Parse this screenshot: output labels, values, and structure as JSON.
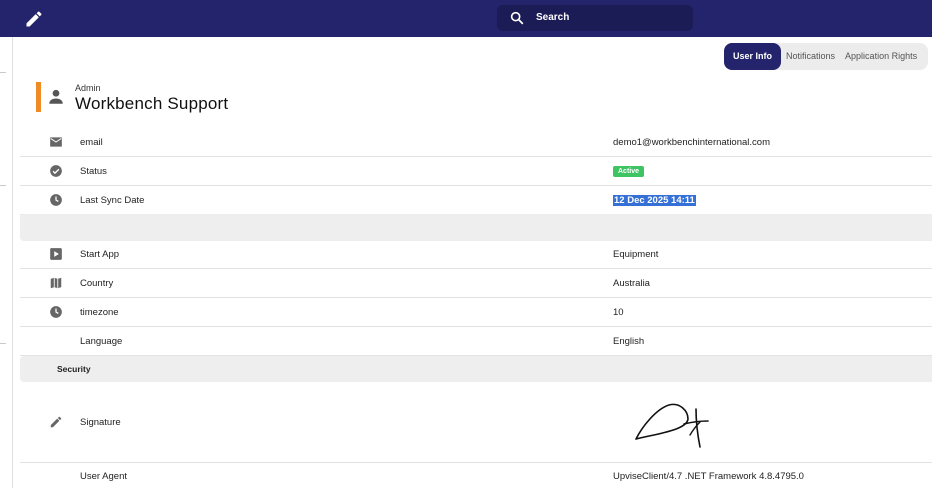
{
  "header": {
    "search_label": "Search"
  },
  "tabs": [
    {
      "label": "User Info",
      "active": true
    },
    {
      "label": "Notifications",
      "active": false
    },
    {
      "label": "Application Rights",
      "active": false
    }
  ],
  "user": {
    "role": "Admin",
    "name": "Workbench Support"
  },
  "rows": {
    "email": {
      "label": "email",
      "value": "demo1@workbenchinternational.com",
      "icon": "mail-icon"
    },
    "status": {
      "label": "Status",
      "value": "Active",
      "icon": "check-circle-icon"
    },
    "last_sync": {
      "label": "Last Sync Date",
      "value": "12 Dec 2025 14:11",
      "icon": "clock-icon"
    },
    "start_app": {
      "label": "Start App",
      "value": "Equipment",
      "icon": "play-icon"
    },
    "country": {
      "label": "Country",
      "value": "Australia",
      "icon": "map-icon"
    },
    "timezone": {
      "label": "timezone",
      "value": "10",
      "icon": "clock-icon"
    },
    "language": {
      "label": "Language",
      "value": "English"
    },
    "signature": {
      "label": "Signature",
      "icon": "pencil-icon"
    },
    "user_agent": {
      "label": "User Agent",
      "value": "UpviseClient/4.7 .NET Framework 4.8.4795.0"
    }
  },
  "sections": {
    "security": "Security"
  },
  "colors": {
    "topbar": "#23246b",
    "accent": "#f08a24",
    "status_active": "#3ec463",
    "selection": "#3470d6"
  }
}
